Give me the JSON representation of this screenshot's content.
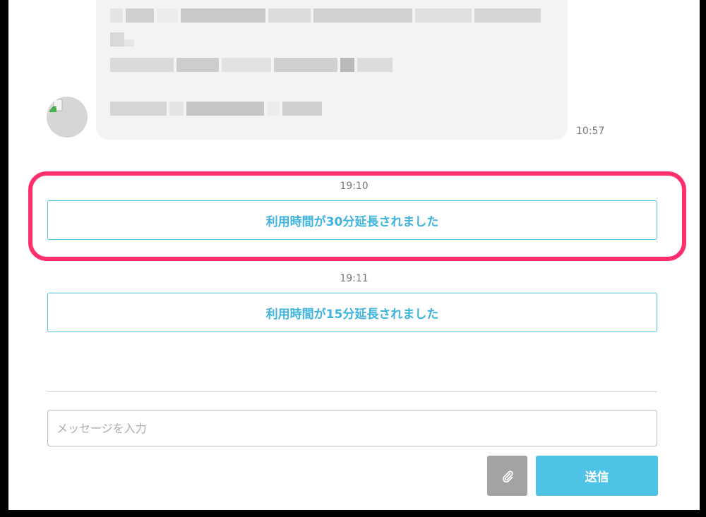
{
  "messages": {
    "incoming_time": "10:57"
  },
  "system_messages": [
    {
      "time": "19:10",
      "text": "利用時間が30分延長されました"
    },
    {
      "time": "19:11",
      "text": "利用時間が15分延長されました"
    }
  ],
  "composer": {
    "placeholder": "メッセージを入力",
    "send_label": "送信",
    "attach_icon": "paperclip-icon"
  },
  "colors": {
    "accent": "#4ec3e6",
    "highlight": "#ff2f6e",
    "bubble": "#f3f3f3",
    "attach_button": "#a3a3a3"
  }
}
